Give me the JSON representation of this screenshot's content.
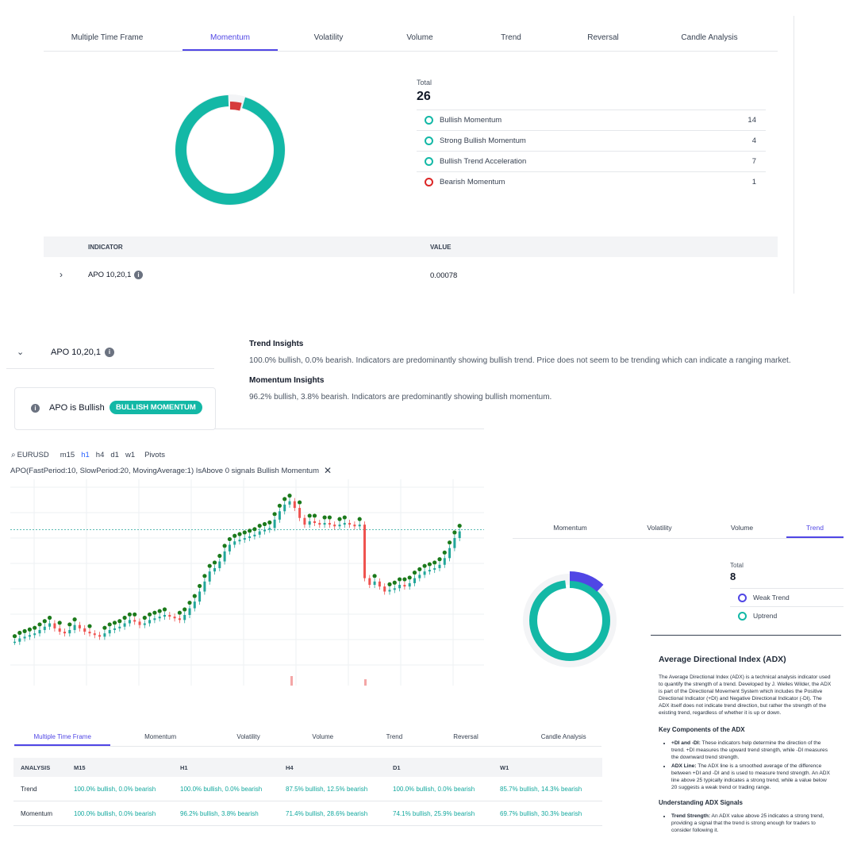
{
  "top_tabs": [
    "Multiple Time Frame",
    "Momentum",
    "Volatility",
    "Volume",
    "Trend",
    "Reversal",
    "Candle Analysis"
  ],
  "summary": {
    "total_label": "Total",
    "total_value": "26",
    "items": [
      {
        "label": "Bullish Momentum",
        "count": "14"
      },
      {
        "label": "Strong Bullish Momentum",
        "count": "4"
      },
      {
        "label": "Bullish Trend Acceleration",
        "count": "7"
      },
      {
        "label": "Bearish Momentum",
        "count": "1"
      }
    ],
    "colors": {
      "bullish": "#13b8a6",
      "bearish": "#dc2626"
    }
  },
  "indicator_table": {
    "col_indicator": "INDICATOR",
    "col_value": "VALUE",
    "row": {
      "name": "APO 10,20,1",
      "value": "0.00078"
    }
  },
  "expanded": {
    "name": "APO 10,20,1",
    "status": "APO is Bullish",
    "badge": "BULLISH MOMENTUM"
  },
  "insights": {
    "trend_title": "Trend Insights",
    "trend_text": "100.0% bullish, 0.0% bearish. Indicators are predominantly showing bullish trend. Price does not seem to be trending which can indicate a ranging market.",
    "momentum_title": "Momentum Insights",
    "momentum_text": "96.2% bullish, 3.8% bearish. Indicators are predominantly showing bullish momentum."
  },
  "chart_toolbar": {
    "symbol": "EURUSD",
    "timeframes": [
      "m15",
      "h1",
      "h4",
      "d1",
      "w1"
    ],
    "active_timeframe": "h1",
    "pivots": "Pivots"
  },
  "chart_caption": "APO(FastPeriod:10, SlowPeriod:20, MovingAverage:1) IsAbove 0 signals Bullish Momentum",
  "chart_data": {
    "type": "candlestick",
    "series": [
      {
        "values": [
          22,
          24,
          25,
          26,
          27,
          29,
          31,
          33,
          30,
          28,
          27,
          29,
          32,
          30,
          28,
          27,
          26,
          25,
          27,
          29,
          30,
          31,
          33,
          35,
          34,
          32,
          33,
          35,
          36,
          37,
          38,
          37,
          36,
          35,
          38,
          42,
          46,
          52,
          58,
          64,
          66,
          70,
          76,
          80,
          82,
          83,
          84,
          85,
          86,
          88,
          89,
          90,
          95,
          100,
          104,
          106,
          102,
          96,
          92,
          94,
          93,
          92,
          93,
          92,
          91,
          92,
          93,
          92,
          91,
          92,
          60,
          56,
          58,
          55,
          52,
          53,
          54,
          56,
          55,
          57,
          60,
          62,
          64,
          65,
          66,
          68,
          72,
          78,
          84,
          88
        ]
      }
    ],
    "marker_color": "#1b7a1b",
    "up_color": "#22a69a",
    "down_color": "#ef5350"
  },
  "mtf_tabs": [
    "Multiple Time Frame",
    "Momentum",
    "Volatility",
    "Volume",
    "Trend",
    "Reversal",
    "Candle Analysis"
  ],
  "mtf_table": {
    "headers": [
      "ANALYSIS",
      "M15",
      "H1",
      "H4",
      "D1",
      "W1"
    ],
    "rows": [
      {
        "label": "Trend",
        "cells": [
          "100.0% bullish, 0.0% bearish",
          "100.0% bullish, 0.0% bearish",
          "87.5% bullish, 12.5% bearish",
          "100.0% bullish, 0.0% bearish",
          "85.7% bullish, 14.3% bearish"
        ]
      },
      {
        "label": "Momentum",
        "cells": [
          "100.0% bullish, 0.0% bearish",
          "96.2% bullish, 3.8% bearish",
          "71.4% bullish, 28.6% bearish",
          "74.1% bullish, 25.9% bearish",
          "69.7% bullish, 30.3% bearish"
        ]
      }
    ]
  },
  "trend_panel": {
    "tabs": [
      "Momentum",
      "Volatility",
      "Volume",
      "Trend"
    ],
    "total_label": "Total",
    "total_value": "8",
    "items": [
      {
        "label": "Weak Trend"
      },
      {
        "label": "Uptrend"
      }
    ],
    "colors": {
      "weak": "#5046e5",
      "up": "#13b8a6"
    }
  },
  "adx": {
    "title": "Average Directional Index (ADX)",
    "intro": "The Average Directional Index (ADX) is a technical analysis indicator used to quantify the strength of a trend. Developed by J. Welles Wilder, the ADX is part of the Directional Movement System which includes the Positive Directional Indicator (+DI) and Negative Directional Indicator (-DI). The ADX itself does not indicate trend direction, but rather the strength of the existing trend, regardless of whether it is up or down.",
    "components_title": "Key Components of the ADX",
    "components": [
      {
        "term": "+DI and -DI:",
        "text": " These indicators help determine the direction of the trend. +DI measures the upward trend strength, while -DI measures the downward trend strength."
      },
      {
        "term": "ADX Line:",
        "text": " The ADX line is a smoothed average of the difference between +DI and -DI and is used to measure trend strength. An ADX line above 25 typically indicates a strong trend, while a value below 20 suggests a weak trend or trading range."
      }
    ],
    "signals_title": "Understanding ADX Signals",
    "signals": [
      {
        "term": "Trend Strength:",
        "text": " An ADX value above 25 indicates a strong trend, providing a signal that the trend is strong enough for traders to consider following it."
      }
    ]
  }
}
